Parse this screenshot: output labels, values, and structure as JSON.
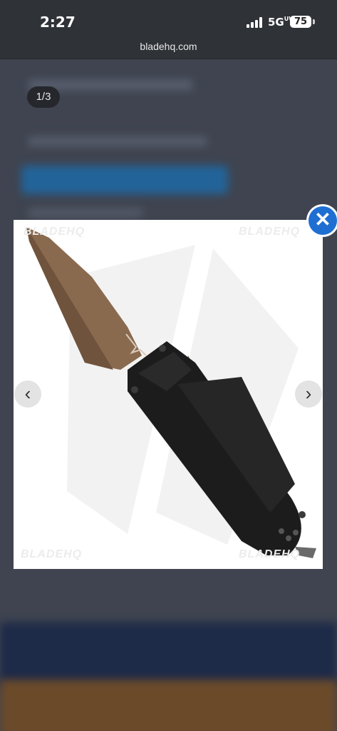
{
  "status_bar": {
    "time": "2:27",
    "network": "5G",
    "network_sup": "UW",
    "battery": "75"
  },
  "browser": {
    "url": "bladehq.com"
  },
  "gallery": {
    "counter": "1/3",
    "watermark": "BLADEHQ",
    "image_subject": "Benchmade automatic knife with bronze blade and black textured handle"
  },
  "icons": {
    "close": "close-icon",
    "prev": "chevron-left-icon",
    "next": "chevron-right-icon"
  },
  "colors": {
    "close_button": "#1f6fd3",
    "blade": "#8a6a4f",
    "handle": "#1c1c1c"
  }
}
